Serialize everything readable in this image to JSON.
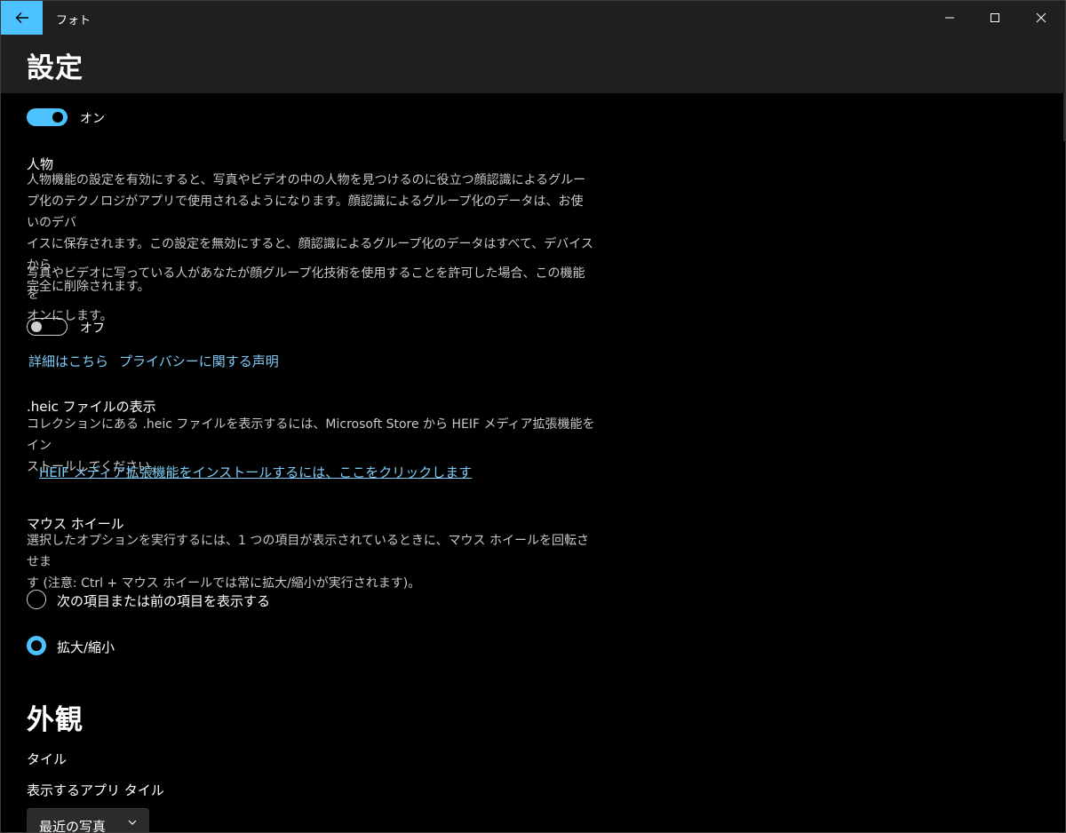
{
  "window": {
    "app_title": "フォト",
    "page_title": "設定"
  },
  "privacy": {
    "top_toggle": {
      "state": "on",
      "label": "オン"
    },
    "people": {
      "heading": "人物",
      "desc_lines": [
        "人物機能の設定を有効にすると、写真やビデオの中の人物を見つけるのに役立つ顔認識によるグルー",
        "プ化のテクノロジがアプリで使用されるようになります。顔認識によるグループ化のデータは、お使いのデバ",
        "イスに保存されます。この設定を無効にすると、顔認識によるグループ化のデータはすべて、デバイスから",
        "完全に削除されます。"
      ],
      "note_lines": [
        "写真やビデオに写っている人があなたが顔グループ化技術を使用することを許可した場合、この機能を",
        "オンにします。"
      ],
      "toggle": {
        "state": "off",
        "label": "オフ"
      },
      "link_details": "詳細はこちら",
      "link_privacy": "プライバシーに関する声明"
    }
  },
  "heic": {
    "heading": ".heic ファイルの表示",
    "desc_lines": [
      "コレクションにある .heic ファイルを表示するには、Microsoft Store から HEIF メディア拡張機能をイン",
      "ストールしてください。"
    ],
    "install_link": "HEIF メディア拡張機能をインストールするには、ここをクリックします"
  },
  "mouse_wheel": {
    "heading": "マウス ホイール",
    "desc_lines": [
      "選択したオプションを実行するには、1 つの項目が表示されているときに、マウス ホイールを回転させま",
      "す (注意: Ctrl + マウス ホイールでは常に拡大/縮小が実行されます)。"
    ],
    "options": [
      {
        "label": "次の項目または前の項目を表示する",
        "selected": false
      },
      {
        "label": "拡大/縮小",
        "selected": true
      }
    ]
  },
  "appearance": {
    "title": "外観",
    "tile_heading": "タイル",
    "tile_sub": "表示するアプリ タイル",
    "tile_dropdown": "最近の写真"
  },
  "colors": {
    "accent": "#4cc2ff",
    "link": "#7ecbf5",
    "titlebar": "#1f1f1f",
    "background": "#000000"
  }
}
